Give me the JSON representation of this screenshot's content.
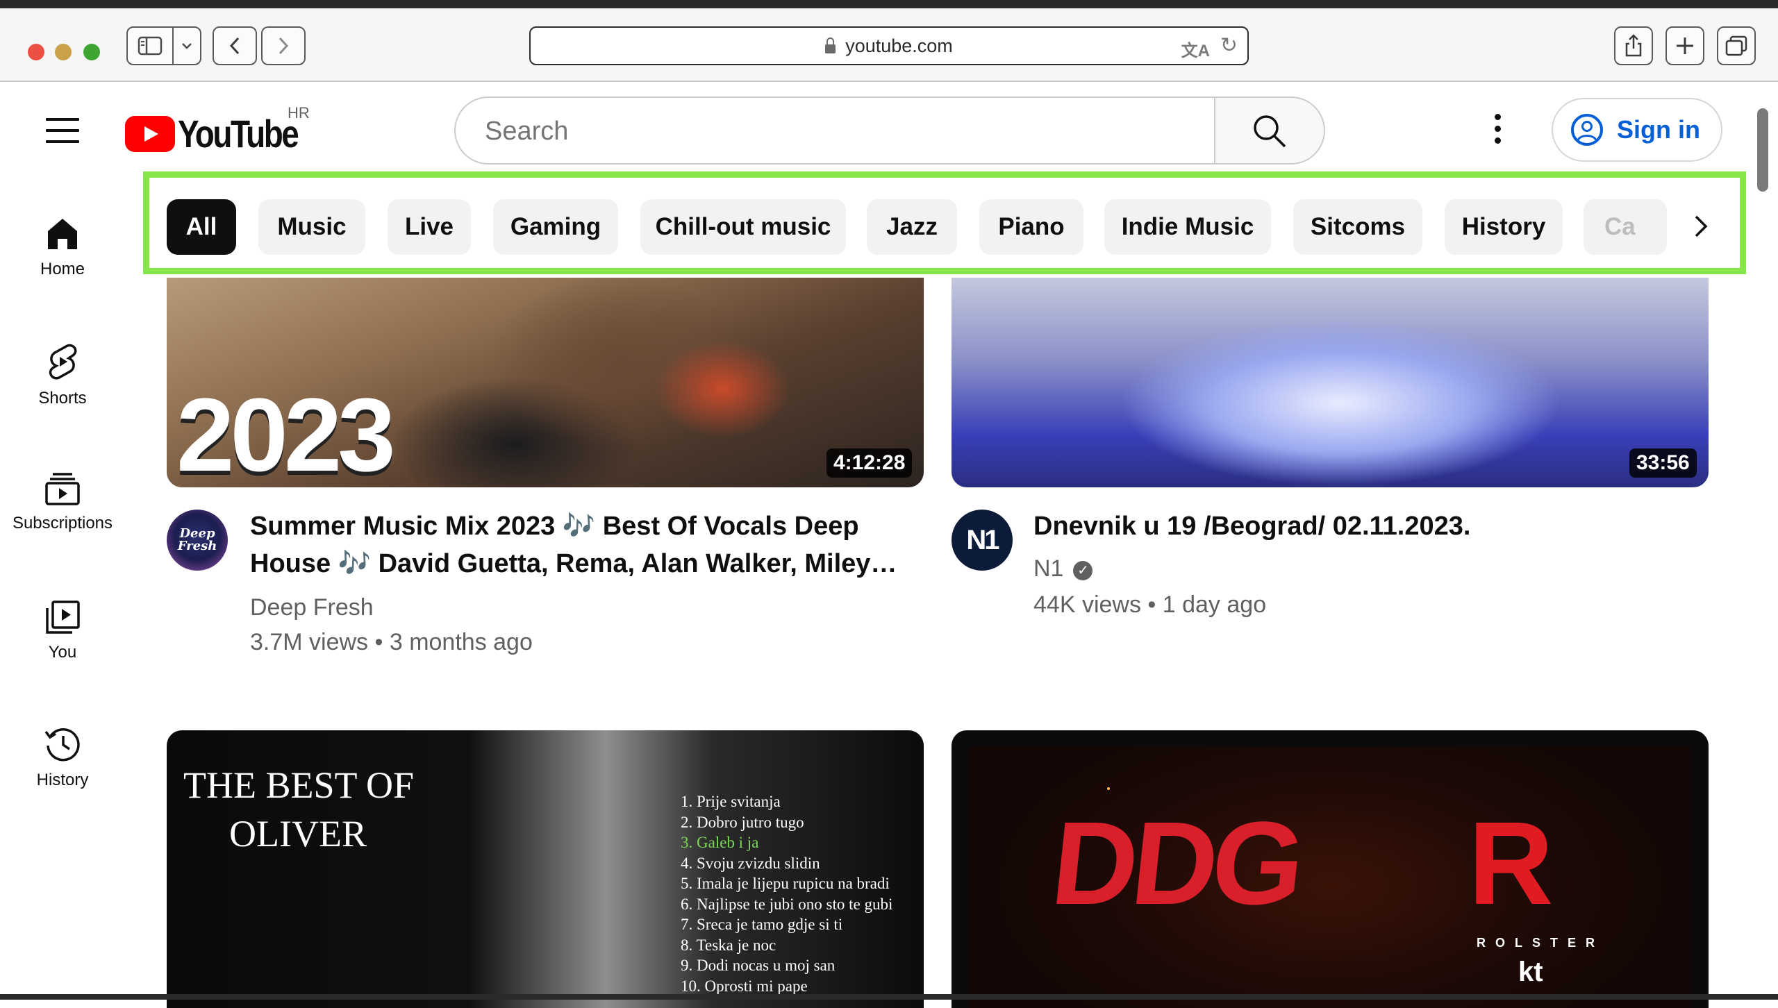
{
  "browser": {
    "url": "youtube.com"
  },
  "header": {
    "logo_text": "YouTube",
    "country_code": "HR",
    "search_placeholder": "Search",
    "sign_in_label": "Sign in"
  },
  "chips": [
    {
      "label": "All",
      "active": true
    },
    {
      "label": "Music"
    },
    {
      "label": "Live"
    },
    {
      "label": "Gaming"
    },
    {
      "label": "Chill-out music"
    },
    {
      "label": "Jazz"
    },
    {
      "label": "Piano"
    },
    {
      "label": "Indie Music"
    },
    {
      "label": "Sitcoms"
    },
    {
      "label": "History"
    },
    {
      "label": "Ca"
    }
  ],
  "sidebar": {
    "items": [
      {
        "label": "Home",
        "icon": "home-icon"
      },
      {
        "label": "Shorts",
        "icon": "shorts-icon"
      },
      {
        "label": "Subscriptions",
        "icon": "subscriptions-icon"
      },
      {
        "label": "You",
        "icon": "you-library-icon"
      },
      {
        "label": "History",
        "icon": "history-icon"
      }
    ]
  },
  "videos": [
    {
      "title_line1": "Summer Music Mix 2023 🎶 Best Of Vocals Deep",
      "title_line2": "House 🎶 David Guetta, Rema, Alan Walker, Miley…",
      "channel": "Deep Fresh",
      "meta": "3.7M views • 3 months ago",
      "duration": "4:12:28",
      "thumb_text": "2023",
      "avatar_text": "Deep Fresh"
    },
    {
      "title_line1": "Dnevnik u 19 /Beograd/ 02.11.2023.",
      "channel": "N1",
      "verified": true,
      "meta": "44K views • 1 day ago",
      "duration": "33:56",
      "avatar_text": "N1"
    },
    {
      "thumb_title_line1": "THE BEST OF",
      "thumb_title_line2": "OLIVER",
      "tracklist": [
        "1. Prije svitanja",
        "2. Dobro jutro tugo",
        "3. Galeb i ja",
        "4. Svoju zvizdu slidin",
        "5. Imala je lijepu rupicu na bradi",
        "6. Najlipse te jubi ono sto te gubi",
        "7. Sreca je tamo gdje si ti",
        "8. Teska je noc",
        "9. Dodi nocas u moj san",
        "10. Oprosti mi pape"
      ]
    },
    {
      "thumb_logo_left": "DDG",
      "thumb_logo_right": "R",
      "thumb_brand": "ROLSTER",
      "thumb_sponsor": "kt"
    }
  ],
  "colors": {
    "youtube_red": "#ff0000",
    "link_blue": "#065fd4",
    "highlight_green": "#86e64a"
  }
}
